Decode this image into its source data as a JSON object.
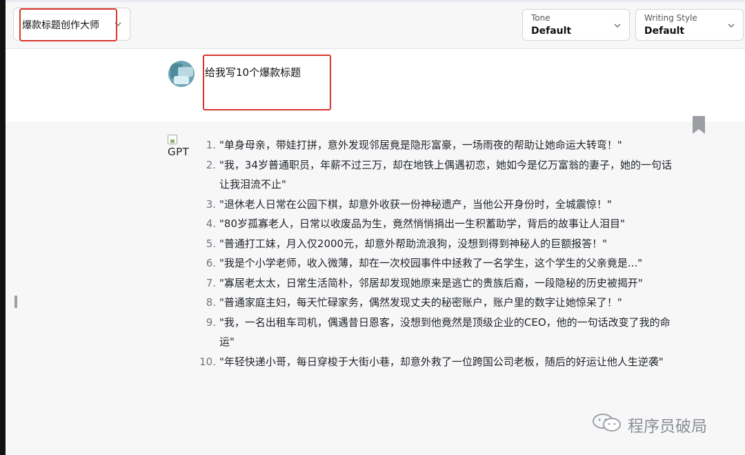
{
  "toolbar": {
    "prompt_template": "爆款标题创作大师",
    "tone": {
      "caption": "Tone",
      "value": "Default"
    },
    "writing_style": {
      "caption": "Writing Style",
      "value": "Default"
    }
  },
  "conversation": {
    "user_message": "给我写10个爆款标题",
    "assistant_avatar_alt": "GPT",
    "titles": [
      {
        "num": "1.",
        "text": "\"单身母亲，带娃打拼，意外发现邻居竟是隐形富豪，一场雨夜的帮助让她命运大转弯！\""
      },
      {
        "num": "2.",
        "text": "\"我，34岁普通职员，年薪不过三万，却在地铁上偶遇初恋，她如今是亿万富翁的妻子，她的一句话让我泪流不止\""
      },
      {
        "num": "3.",
        "text": "\"退休老人日常在公园下棋，却意外收获一份神秘遗产，当他公开身份时，全城震惊！\""
      },
      {
        "num": "4.",
        "text": "\"80岁孤寡老人，日常以收废品为生，竟然悄悄捐出一生积蓄助学，背后的故事让人泪目\""
      },
      {
        "num": "5.",
        "text": "\"普通打工妹，月入仅2000元，却意外帮助流浪狗，没想到得到神秘人的巨额报答！\""
      },
      {
        "num": "6.",
        "text": "\"我是个小学老师，收入微薄，却在一次校园事件中拯救了一名学生，这个学生的父亲竟是...\""
      },
      {
        "num": "7.",
        "text": "\"寡居老太太，日常生活简朴，邻居却发现她原来是逃亡的贵族后裔，一段隐秘的历史被揭开\""
      },
      {
        "num": "8.",
        "text": "\"普通家庭主妇，每天忙碌家务，偶然发现丈夫的秘密账户，账户里的数字让她惊呆了！\""
      },
      {
        "num": "9.",
        "text": "\"我，一名出租车司机，偶遇昔日恩客，没想到他竟然是顶级企业的CEO，他的一句话改变了我的命运\""
      },
      {
        "num": "10.",
        "text": "\"年轻快递小哥，每日穿梭于大街小巷，却意外救了一位跨国公司老板，随后的好运让他人生逆袭\""
      }
    ]
  },
  "watermark": {
    "text": "程序员破局"
  },
  "colors": {
    "highlight": "#d9342b",
    "panel": "#f7f7f8",
    "muted_number": "#6e7781"
  }
}
